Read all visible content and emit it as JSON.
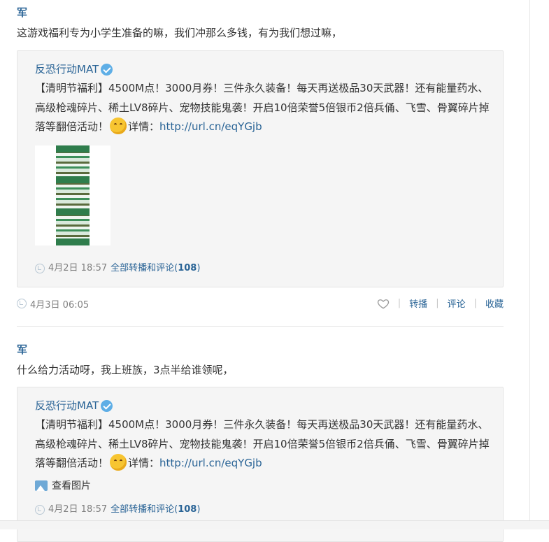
{
  "posts": [
    {
      "author": "军",
      "text": "这游戏福利专为小学生准备的嘛，我们冲那么多钱，有为我们想过嘛，",
      "quote": {
        "author": "反恐行动MAT",
        "text_before_emoji": "【清明节福利】4500M点！3000月券！三件永久装备！每天再送极品30天武器！还有能量药水、高级枪魂碎片、稀土LV8碎片、宠物技能鬼袭！开启10倍荣誉5倍银币2倍兵俑、飞雪、骨翼碎片掉落等翻倍活动！",
        "details_label": "详情：",
        "link": "http://url.cn/eqYGjb",
        "has_thumbnail": true,
        "meta_time": "4月2日 18:57",
        "meta_all": "全部转播和评论(",
        "meta_count": "108",
        "meta_close": ")"
      },
      "time": "4月3日 06:05",
      "actions": [
        "转播",
        "评论",
        "收藏"
      ]
    },
    {
      "author": "军",
      "text": "什么给力活动呀，我上班族，3点半给谁领呢，",
      "quote": {
        "author": "反恐行动MAT",
        "text_before_emoji": "【清明节福利】4500M点！3000月券！三件永久装备！每天再送极品30天武器！还有能量药水、高级枪魂碎片、稀土LV8碎片、宠物技能鬼袭！开启10倍荣誉5倍银币2倍兵俑、飞雪、骨翼碎片掉落等翻倍活动！",
        "details_label": "详情：",
        "link": "http://url.cn/eqYGjb",
        "view_pic": "查看图片",
        "meta_time": "4月2日 18:57",
        "meta_all": "全部转播和评论(",
        "meta_count": "108",
        "meta_close": ")"
      }
    }
  ],
  "icons": {
    "verified": "verified-badge-icon",
    "emoji": "shy-face-emoji-icon",
    "meta": "rebroadcast-icon",
    "heart": "heart-icon",
    "picture": "picture-icon"
  },
  "colors": {
    "link": "#2a6496",
    "meta": "#808080",
    "quote_bg": "#f5f5f5",
    "verified": "#5eaee6"
  }
}
